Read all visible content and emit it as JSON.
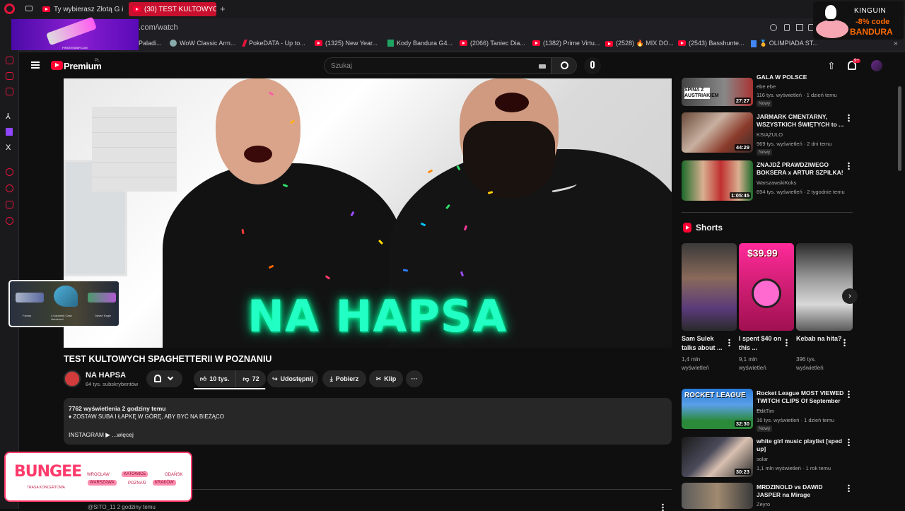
{
  "browser": {
    "tabs": [
      {
        "label": "Ty wybierasz Złotą G i K..."
      },
      {
        "label": "(30) TEST KULTOWYCH S..."
      }
    ],
    "url": ".com/watch",
    "new_tab": "+",
    "bookmarks": [
      {
        "label": "Paladi..."
      },
      {
        "label": "WoW Classic Arm..."
      },
      {
        "label": "PokeDATA - Up to..."
      },
      {
        "label": "(1325) New Year..."
      },
      {
        "label": "Kody Bandura G4..."
      },
      {
        "label": "(2066) Taniec Dia..."
      },
      {
        "label": "(1382) Prime Virtu..."
      },
      {
        "label": "(2528) 🔥 MIX DO..."
      },
      {
        "label": "(2543) Basshunte..."
      },
      {
        "label": "🏅 OLIMPIADA ST..."
      }
    ]
  },
  "ads": {
    "top_left_caption": "PIRATESWAP.COM",
    "kinguin_logo": "KINGUIN",
    "kinguin_discount": "-8% code",
    "kinguin_code": "BANDURA",
    "bungee_title": "BUNGEE",
    "bungee_subtitle": "TRASA KONCERTOWA",
    "bungee_cities": [
      "WROCŁAW",
      "KATOWICE",
      "GDAŃSK",
      "WARSZAWA",
      "POZNAŃ",
      "KRAKÓW"
    ],
    "cs_items": [
      "Famas",
      "4 Karambit Case Hardened",
      "Desert Eagle"
    ]
  },
  "youtube": {
    "logo_label": "Premium",
    "region": "PL",
    "search_placeholder": "Szukaj",
    "notif_count": "9+"
  },
  "video": {
    "overlay_text": "NA HAPSA",
    "title": "TEST KULTOWYCH SPAGHETTERII W POZNANIU",
    "channel": "NA HAPSA",
    "subscribers": "84 tys. subskrybentów",
    "likes": "10 tys.",
    "dislikes": "72",
    "share": "Udostępnij",
    "download": "Pobierz",
    "clip": "Klip",
    "desc_meta": "7762 wyświetlenia  2 godziny temu",
    "desc_line": "♦ ZOSTAW SUBA I ŁAPKĘ W GÓRĘ, ABY BYĆ NA BIEŻĄCO",
    "desc_more": "INSTAGRAM ▶   ...więcej",
    "comment_preview": "@SITO_11  2 godziny temu"
  },
  "recommendations": [
    {
      "title": "GALA W POLSCE",
      "channel": "ebe ebe",
      "meta": "116 tys. wyświetleń · 1 dzień temu",
      "badge": "Nowy",
      "duration": "27:27",
      "thumb_text": "SPINA Z AUSTRIAKIEM"
    },
    {
      "title": "JARMARK CMENTARNY, WSZYSTKICH ŚWIĘTYCH to ...",
      "channel": "KSIĄŻULO",
      "meta": "969 tys. wyświetleń · 2 dni temu",
      "badge": "Nowy",
      "duration": "44:29"
    },
    {
      "title": "ZNAJDŹ PRAWDZIWEGO BOKSERA x ARTUR SZPILKA!",
      "channel": "WarszawskiKoks",
      "meta": "694 tys. wyświetleń · 2 tygodnie temu",
      "duration": "1:05:45"
    }
  ],
  "shorts": {
    "heading": "Shorts",
    "items": [
      {
        "title": "Sam Sulek talks about ...",
        "views": "1,4 mln wyświetleń"
      },
      {
        "title": "I spent $40 on this ...",
        "views": "9,1 mln wyświetleń",
        "thumb_price": "$39.99"
      },
      {
        "title": "Kebab na hita?",
        "views": "396 tys. wyświetleń"
      }
    ]
  },
  "recommendations2": [
    {
      "title": "Rocket League MOST VIEWED TWITCH CLIPS Of September ...",
      "channel": "EditTim",
      "meta": "16 tys. wyświetleń · 1 dzień temu",
      "badge": "Nowy",
      "duration": "32:30",
      "thumb_text": "ROCKET LEAGUE"
    },
    {
      "title": "white girl music playlist [sped up]",
      "channel": "solar",
      "meta": "1,1 mln wyświetleń · 1 rok temu",
      "duration": "30:23"
    },
    {
      "title": "MRDZINOLD vs DAWID JASPER na Mirage",
      "channel": "Zeyro",
      "meta": ""
    }
  ],
  "colors": {
    "accent": "#ff0033",
    "opera": "#e4153b",
    "neon": "#22ffc4"
  }
}
